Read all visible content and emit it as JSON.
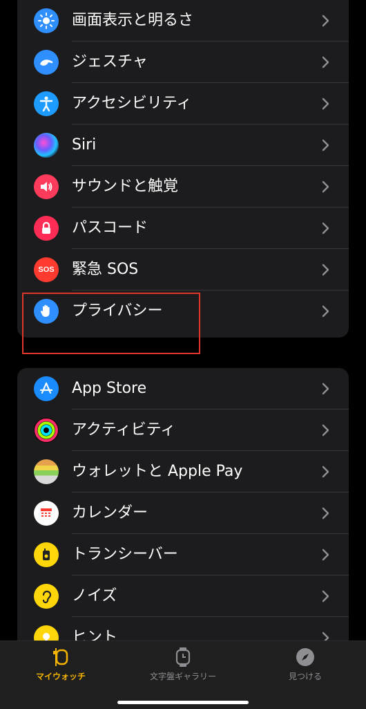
{
  "groups": [
    {
      "items": [
        {
          "label": "画面表示と明るさ",
          "icon": "brightness-icon",
          "color": "#2f8fff"
        },
        {
          "label": "ジェスチャ",
          "icon": "gesture-hand-icon",
          "color": "#2f8fff"
        },
        {
          "label": "アクセシビリティ",
          "icon": "accessibility-icon",
          "color": "#1e9bff"
        },
        {
          "label": "Siri",
          "icon": "siri-icon",
          "color": "#303050"
        },
        {
          "label": "サウンドと触覚",
          "icon": "speaker-icon",
          "color": "#ff3b5c"
        },
        {
          "label": "パスコード",
          "icon": "lock-icon",
          "color": "#ff2d55"
        },
        {
          "label": "緊急 SOS",
          "icon": "sos-icon",
          "color": "#ff3b30",
          "badge": "SOS"
        },
        {
          "label": "プライバシー",
          "icon": "privacy-hand-icon",
          "color": "#2f8fff"
        }
      ]
    },
    {
      "items": [
        {
          "label": "App Store",
          "icon": "app-store-icon",
          "color": "#1b8cff"
        },
        {
          "label": "アクティビティ",
          "icon": "activity-rings-icon",
          "color": "#000000"
        },
        {
          "label": "ウォレットと Apple Pay",
          "icon": "wallet-icon",
          "color": "#8a9ea0"
        },
        {
          "label": "カレンダー",
          "icon": "calendar-icon",
          "color": "#ffffff"
        },
        {
          "label": "トランシーバー",
          "icon": "walkie-talkie-icon",
          "color": "#ffd60a"
        },
        {
          "label": "ノイズ",
          "icon": "ear-icon",
          "color": "#ffd60a"
        },
        {
          "label": "ヒント",
          "icon": "tips-icon",
          "color": "#ffd60a"
        }
      ]
    }
  ],
  "tabbar": {
    "tabs": [
      {
        "label": "マイウォッチ",
        "icon": "watch-icon",
        "active": true
      },
      {
        "label": "文字盤ギャラリー",
        "icon": "watch-face-icon",
        "active": false
      },
      {
        "label": "見つける",
        "icon": "compass-icon",
        "active": false
      }
    ]
  },
  "colors": {
    "accent": "#f5b400",
    "highlight": "#e0372a"
  }
}
